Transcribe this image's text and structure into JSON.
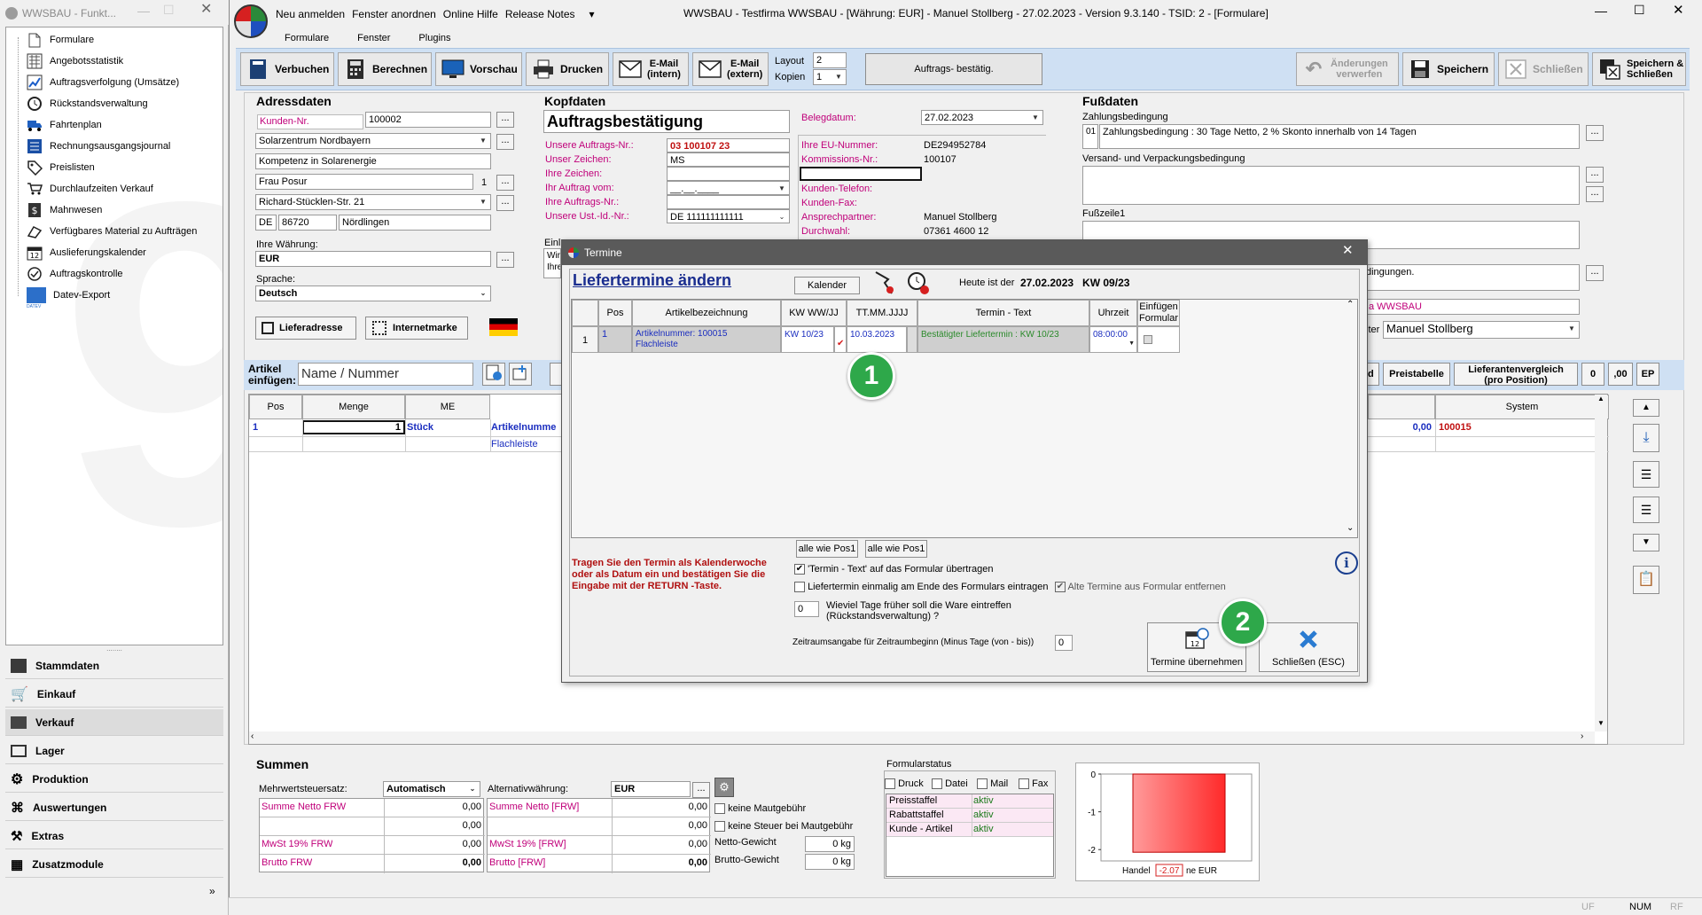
{
  "sidebar": {
    "title": "WWSBAU - Funkt...",
    "items": [
      {
        "label": "Formulare"
      },
      {
        "label": "Angebotsstatistik"
      },
      {
        "label": "Auftragsverfolgung (Umsätze)"
      },
      {
        "label": "Rückstandsverwaltung"
      },
      {
        "label": "Fahrtenplan"
      },
      {
        "label": "Rechnungsausgangsjournal"
      },
      {
        "label": "Preislisten"
      },
      {
        "label": "Durchlaufzeiten Verkauf"
      },
      {
        "label": "Mahnwesen"
      },
      {
        "label": "Verfügbares Material zu Aufträgen"
      },
      {
        "label": "Auslieferungskalender"
      },
      {
        "label": "Auftragskontrolle"
      },
      {
        "label": "Datev-Export"
      }
    ],
    "datev_small": "DATEV",
    "nav": [
      {
        "label": "Stammdaten"
      },
      {
        "label": "Einkauf"
      },
      {
        "label": "Verkauf"
      },
      {
        "label": "Lager"
      },
      {
        "label": "Produktion"
      },
      {
        "label": "Auswertungen"
      },
      {
        "label": "Extras"
      },
      {
        "label": "Zusatzmodule"
      }
    ]
  },
  "menu": {
    "items": [
      "Neu anmelden",
      "Fenster anordnen",
      "Online Hilfe",
      "Release Notes"
    ],
    "title": "WWSBAU - Testfirma WWSBAU - [Währung: EUR] - Manuel Stollberg - 27.02.2023 - Version 9.3.140 - TSID: 2  - [Formulare]",
    "sub": [
      "Formulare",
      "Fenster",
      "Plugins"
    ]
  },
  "toolbar": {
    "verbuchen": "Verbuchen",
    "berechnen": "Berechnen",
    "vorschau": "Vorschau",
    "drucken": "Drucken",
    "email_intern_1": "E-Mail",
    "email_intern_2": "(intern)",
    "email_extern_1": "E-Mail",
    "email_extern_2": "(extern)",
    "layout_label": "Layout",
    "layout_value": "2",
    "kopien_label": "Kopien",
    "kopien_value": "1",
    "auftrag_btn": "Auftrags- bestätig.",
    "aenderungen_1": "Änderungen",
    "aenderungen_2": "verwerfen",
    "speichern": "Speichern",
    "schliessen": "Schließen",
    "speichern_schliessen_1": "Speichern &",
    "speichern_schliessen_2": "Schließen"
  },
  "address": {
    "heading": "Adressdaten",
    "kunden_nr_label": "Kunden-Nr.",
    "kunden_nr": "100002",
    "name1": "Solarzentrum Nordbayern",
    "name2": "Kompetenz in Solarenergie",
    "contact": "Frau Posur",
    "contact_num": "1",
    "street": "Richard-Stücklen-Str. 21",
    "country": "DE",
    "plz": "86720",
    "city": "Nördlingen",
    "waehrung_label": "Ihre Währung:",
    "waehrung": "EUR",
    "sprache_label": "Sprache:",
    "sprache": "Deutsch",
    "lieferadresse": "Lieferadresse",
    "internetmarke": "Internetmarke"
  },
  "kopf": {
    "heading": "Kopfdaten",
    "title": "Auftragsbestätigung",
    "labels": [
      "Unsere Auftrags-Nr.:",
      "Unser Zeichen:",
      "Ihre Zeichen:",
      "Ihr Auftrag vom:",
      "Ihre Auftrags-Nr.:",
      "Unsere Ust.-Id.-Nr.:"
    ],
    "values": [
      "03 100107 23",
      "MS",
      "",
      "__.__.____",
      "",
      ""
    ],
    "ust_value": "DE 111111111111",
    "right_labels": [
      "Belegdatum:",
      "Ihre EU-Nummer:",
      "Kommissions-Nr.:",
      "",
      "Kunden-Telefon:",
      "Kunden-Fax:",
      "Ansprechpartner:",
      "Durchwahl:"
    ],
    "right_values": [
      "27.02.2023",
      "DE294952784",
      "100107",
      "",
      "",
      "",
      "Manuel Stollberg",
      "07361 4600 12"
    ],
    "einl_label": "Einl",
    "einl_lines": [
      "Wir",
      "Ihre"
    ]
  },
  "fuss": {
    "heading": "Fußdaten",
    "zahlung_label": "Zahlungsbedingung",
    "zahlung_code": "01",
    "zahlung": "Zahlungsbedingung : 30 Tage Netto, 2 % Skonto innerhalb von 14 Tagen",
    "versand_label": "Versand- und Verpackungsbedingung",
    "fusszeile_label": "Fußzeile1",
    "bedingungen": "dingungen.",
    "firma": "a WWSBAU",
    "bearbeiter_label": "iter",
    "bearbeiter": "Manuel Stollberg"
  },
  "artikel": {
    "label_1": "Artikel",
    "label_2": "einfügen:",
    "placeholder": "Name / Nummer",
    "right_btns": [
      "nd",
      "Preistabelle",
      "Lieferantenvergleich (pro Position)",
      "0",
      ",00",
      "EP"
    ],
    "cols": [
      "Pos",
      "Menge",
      "ME"
    ],
    "row1": {
      "pos": "1",
      "menge": "1",
      "me": "Stück",
      "art": "Artikelnumme"
    },
    "row2": {
      "art": "Flachleiste"
    },
    "system_col": "System",
    "price": "0,00",
    "sysnum": "100015"
  },
  "summen": {
    "heading": "Summen",
    "mwst_label": "Mehrwertsteuersatz:",
    "mwst_value": "Automatisch",
    "alt_label": "Alternativwährung:",
    "alt_value": "EUR",
    "left": [
      {
        "l": "Summe Netto FRW",
        "v": "0,00"
      },
      {
        "l": "",
        "v": "0,00"
      },
      {
        "l": "MwSt 19% FRW",
        "v": "0,00"
      },
      {
        "l": "Brutto FRW",
        "v": "0,00"
      }
    ],
    "mid": [
      {
        "l": "Summe Netto [FRW]",
        "v": "0,00"
      },
      {
        "l": "",
        "v": "0,00"
      },
      {
        "l": "MwSt 19% [FRW]",
        "v": "0,00"
      },
      {
        "l": "Brutto [FRW]",
        "v": "0,00"
      }
    ],
    "keine_maut": "keine Mautgebühr",
    "keine_steuer": "keine Steuer bei Mautgebühr",
    "netto_gewicht": "Netto-Gewicht",
    "netto_value": "0 kg",
    "brutto_gewicht": "Brutto-Gewicht",
    "brutto_value": "0 kg"
  },
  "formularstatus": {
    "heading": "Formularstatus",
    "checks": [
      "Druck",
      "Datei",
      "Mail",
      "Fax"
    ],
    "rows": [
      {
        "k": "Preisstaffel",
        "v": "aktiv"
      },
      {
        "k": "Rabattstaffel",
        "v": "aktiv"
      },
      {
        "k": "Kunde - Artikel",
        "v": "aktiv"
      }
    ]
  },
  "chart_data": {
    "type": "bar",
    "categories": [
      "Handel"
    ],
    "values": [
      -2.07
    ],
    "value_label": "-2.07",
    "xlabel": "Handel -2.07 ne EUR",
    "xlabel_left": "Handel",
    "xlabel_right": "ne EUR",
    "ylim": [
      -2.3,
      0
    ],
    "yticks": [
      "0",
      "-1",
      "-2"
    ],
    "bar_color": "#ff2a2a"
  },
  "dialog": {
    "title": "Termine",
    "heading": "Liefertermine ändern",
    "kalender": "Kalender",
    "heute_label": "Heute ist der",
    "heute": "27.02.2023   KW 09/23",
    "cols": [
      "Pos",
      "Artikelbezeichnung",
      "KW WW/JJ",
      "TT.MM.JJJJ",
      "Termin - Text",
      "Uhrzeit",
      "Einfügen Formular"
    ],
    "row": {
      "num": "1",
      "pos": "1",
      "art1": "Artikelnummer: 100015",
      "art2": "Flachleiste",
      "kw": "KW 10/23",
      "datum": "10.03.2023",
      "text": "Bestätigter Liefertermin : KW 10/23",
      "uhrzeit": "08:00:00"
    },
    "alle1": "alle wie Pos1",
    "alle2": "alle wie Pos1",
    "instruction": "Tragen Sie den Termin als Kalenderwoche oder als Datum ein und bestätigen Sie die Eingabe mit der RETURN -Taste.",
    "opt1": "'Termin - Text' auf das Formular übertragen",
    "opt2": "Liefertermin einmalig am Ende des Formulars eintragen",
    "opt3": "Alte Termine aus Formular entfernen",
    "tage_value": "0",
    "tage_label_1": "Wieviel Tage früher soll die Ware eintreffen",
    "tage_label_2": "(Rückstandsverwaltung) ?",
    "zeitraum_label": "Zeitraumsangabe für Zeitraumbeginn (Minus Tage  (von - bis))",
    "zeitraum_value": "0",
    "uebernehmen": "Termine übernehmen",
    "schliessen": "Schließen (ESC)"
  },
  "badges": [
    "1",
    "2"
  ],
  "status": {
    "uf": "UF",
    "num": "NUM",
    "rf": "RF"
  }
}
